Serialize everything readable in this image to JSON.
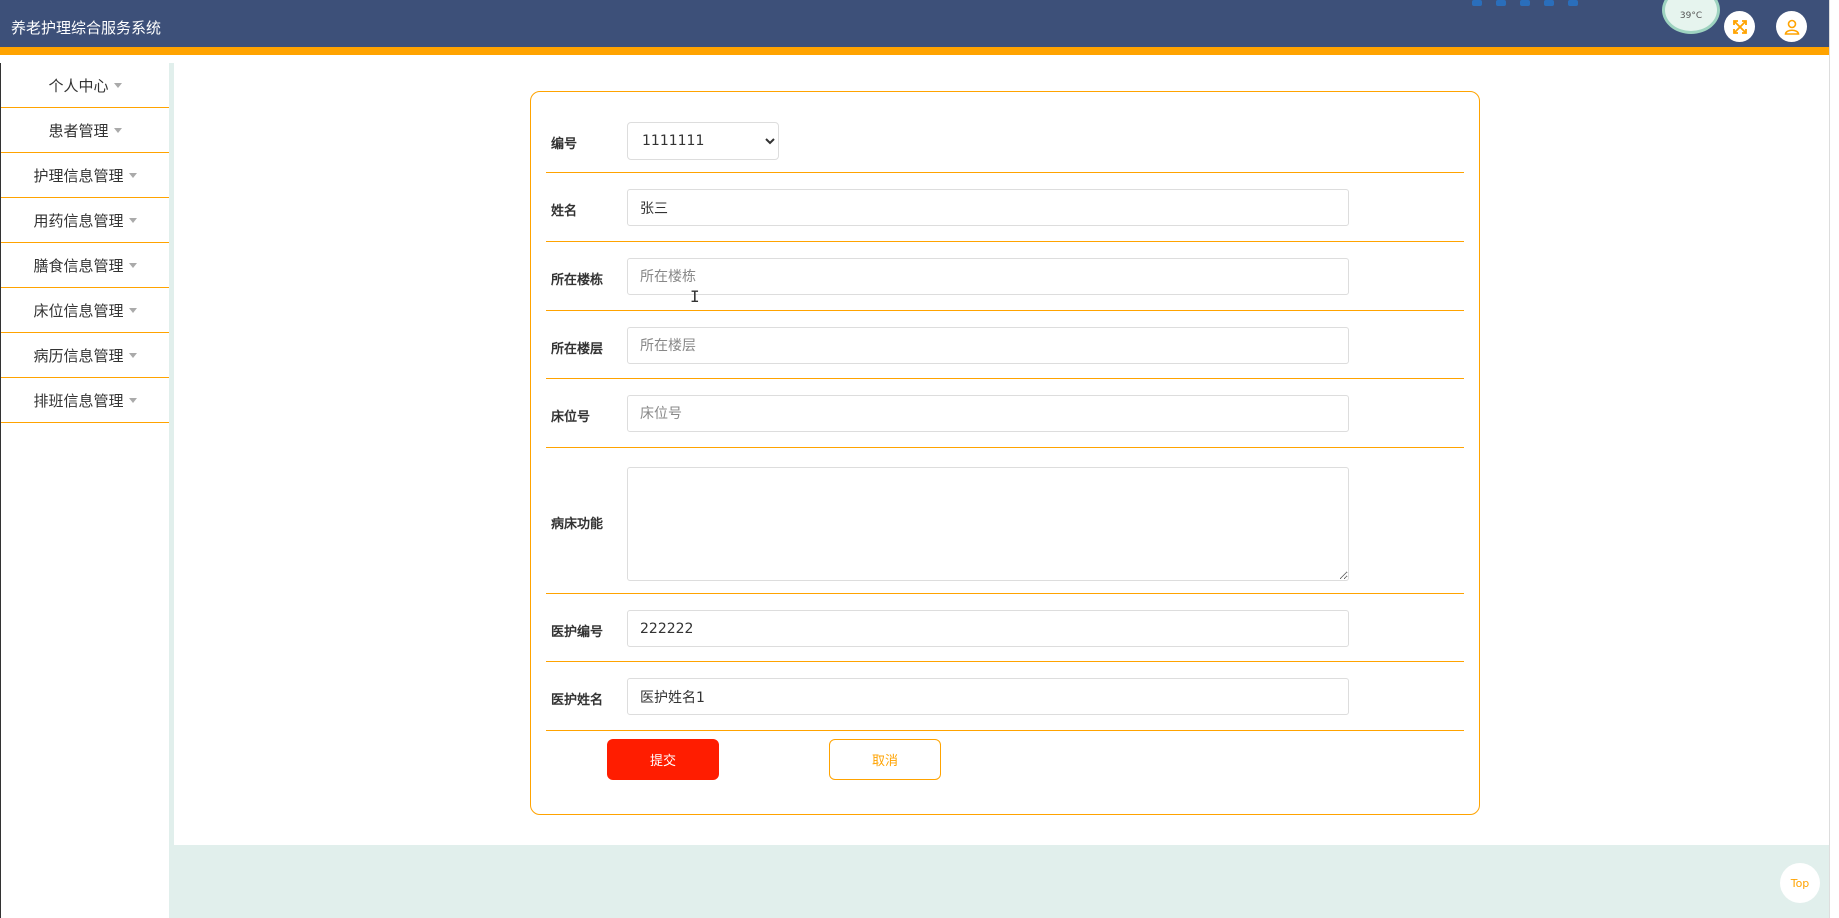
{
  "app": {
    "title": "养老护理综合服务系统"
  },
  "header": {
    "weather_temp": "39°C",
    "icons": {
      "fullscreen": "fullscreen-icon",
      "user": "user-icon"
    }
  },
  "sidebar": {
    "items": [
      {
        "label": "个人中心"
      },
      {
        "label": "患者管理"
      },
      {
        "label": "护理信息管理"
      },
      {
        "label": "用药信息管理"
      },
      {
        "label": "膳食信息管理"
      },
      {
        "label": "床位信息管理"
      },
      {
        "label": "病历信息管理"
      },
      {
        "label": "排班信息管理"
      }
    ]
  },
  "form": {
    "fields": {
      "number": {
        "label": "编号",
        "value": "1111111"
      },
      "name": {
        "label": "姓名",
        "value": "张三"
      },
      "building": {
        "label": "所在楼栋",
        "placeholder": "所在楼栋"
      },
      "floor": {
        "label": "所在楼层",
        "placeholder": "所在楼层"
      },
      "bed_number": {
        "label": "床位号",
        "placeholder": "床位号"
      },
      "bed_function": {
        "label": "病床功能"
      },
      "staff_number": {
        "label": "医护编号",
        "value": "222222"
      },
      "staff_name": {
        "label": "医护姓名",
        "value": "医护姓名1"
      }
    },
    "submit_label": "提交",
    "cancel_label": "取消"
  },
  "scroll_top_label": "Top",
  "colors": {
    "header": "#3d5079",
    "accent": "#ffa300",
    "submit": "#ff1d00",
    "page_bg": "#e1efec"
  }
}
